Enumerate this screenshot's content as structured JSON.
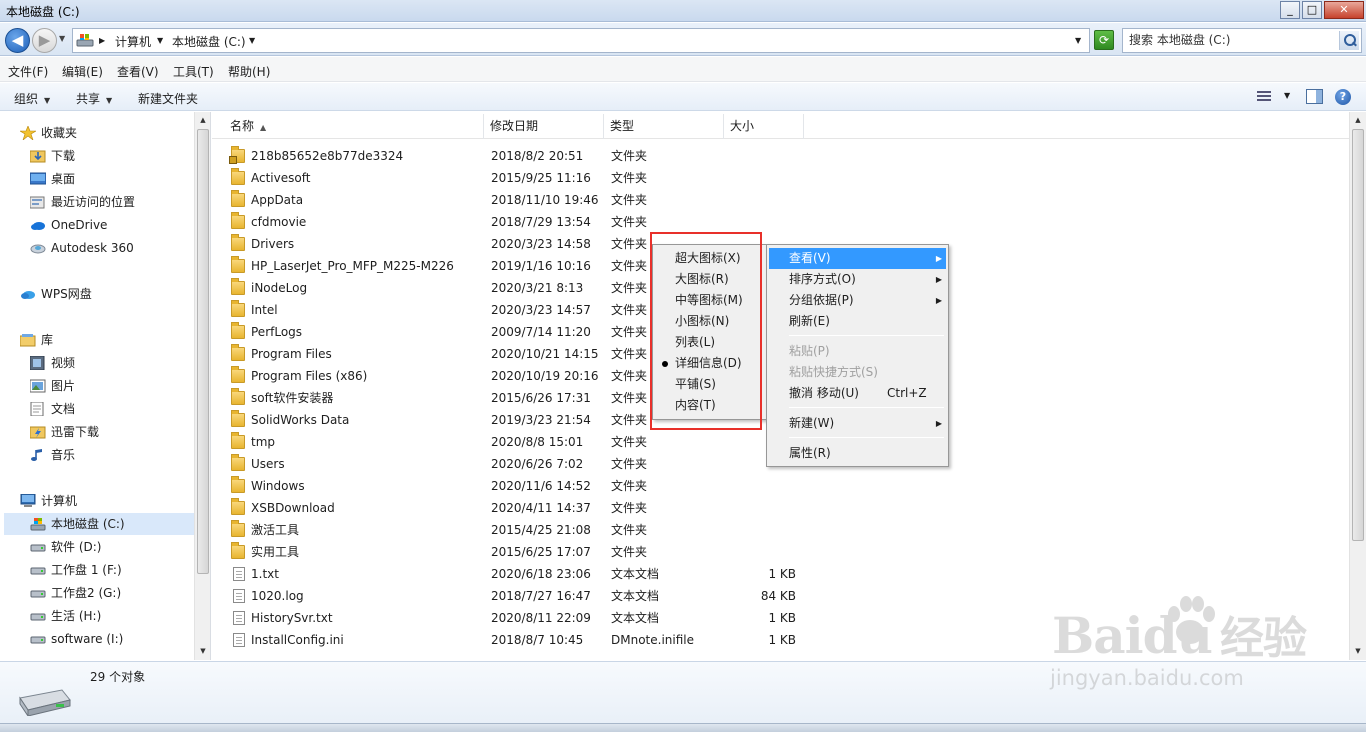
{
  "window": {
    "title": "本地磁盘 (C:)",
    "min": "_",
    "max": "□",
    "close": "✕"
  },
  "address": {
    "crumbs": [
      "计算机",
      "本地磁盘 (C:)"
    ]
  },
  "search": {
    "placeholder": "搜索 本地磁盘 (C:)"
  },
  "menubar": [
    "文件(F)",
    "编辑(E)",
    "查看(V)",
    "工具(T)",
    "帮助(H)"
  ],
  "commands": {
    "organize": "组织",
    "share": "共享",
    "new_folder": "新建文件夹"
  },
  "nav": {
    "favorites": "收藏夹",
    "favorite_items": [
      "下载",
      "桌面",
      "最近访问的位置"
    ],
    "onedrive": "OneDrive",
    "autodesk": "Autodesk 360",
    "wps": "WPS网盘",
    "libraries": "库",
    "library_items": [
      "视频",
      "图片",
      "文档",
      "迅雷下载",
      "音乐"
    ],
    "computer": "计算机",
    "drives": [
      "本地磁盘 (C:)",
      "软件 (D:)",
      "工作盘 1 (F:)",
      "工作盘2 (G:)",
      "生活 (H:)",
      "software (I:)"
    ]
  },
  "columns": {
    "name": "名称",
    "date": "修改日期",
    "type": "类型",
    "size": "大小"
  },
  "files": [
    {
      "name": "218b85652e8b77de3324",
      "date": "2018/8/2 20:51",
      "type": "文件夹",
      "size": "",
      "kind": "lock"
    },
    {
      "name": "Activesoft",
      "date": "2015/9/25 11:16",
      "type": "文件夹",
      "size": "",
      "kind": "folder"
    },
    {
      "name": "AppData",
      "date": "2018/11/10 19:46",
      "type": "文件夹",
      "size": "",
      "kind": "folder"
    },
    {
      "name": "cfdmovie",
      "date": "2018/7/29 13:54",
      "type": "文件夹",
      "size": "",
      "kind": "folder"
    },
    {
      "name": "Drivers",
      "date": "2020/3/23 14:58",
      "type": "文件夹",
      "size": "",
      "kind": "folder"
    },
    {
      "name": "HP_LaserJet_Pro_MFP_M225-M226",
      "date": "2019/1/16 10:16",
      "type": "文件夹",
      "size": "",
      "kind": "folder"
    },
    {
      "name": "iNodeLog",
      "date": "2020/3/21 8:13",
      "type": "文件夹",
      "size": "",
      "kind": "folder"
    },
    {
      "name": "Intel",
      "date": "2020/3/23 14:57",
      "type": "文件夹",
      "size": "",
      "kind": "folder"
    },
    {
      "name": "PerfLogs",
      "date": "2009/7/14 11:20",
      "type": "文件夹",
      "size": "",
      "kind": "folder"
    },
    {
      "name": "Program Files",
      "date": "2020/10/21 14:15",
      "type": "文件夹",
      "size": "",
      "kind": "folder"
    },
    {
      "name": "Program Files (x86)",
      "date": "2020/10/19 20:16",
      "type": "文件夹",
      "size": "",
      "kind": "folder"
    },
    {
      "name": "soft软件安装器",
      "date": "2015/6/26 17:31",
      "type": "文件夹",
      "size": "",
      "kind": "folder"
    },
    {
      "name": "SolidWorks Data",
      "date": "2019/3/23 21:54",
      "type": "文件夹",
      "size": "",
      "kind": "folder"
    },
    {
      "name": "tmp",
      "date": "2020/8/8 15:01",
      "type": "文件夹",
      "size": "",
      "kind": "folder"
    },
    {
      "name": "Users",
      "date": "2020/6/26 7:02",
      "type": "文件夹",
      "size": "",
      "kind": "folder"
    },
    {
      "name": "Windows",
      "date": "2020/11/6 14:52",
      "type": "文件夹",
      "size": "",
      "kind": "folder"
    },
    {
      "name": "XSBDownload",
      "date": "2020/4/11 14:37",
      "type": "文件夹",
      "size": "",
      "kind": "folder"
    },
    {
      "name": "激活工具",
      "date": "2015/4/25 21:08",
      "type": "文件夹",
      "size": "",
      "kind": "folder"
    },
    {
      "name": "实用工具",
      "date": "2015/6/25 17:07",
      "type": "文件夹",
      "size": "",
      "kind": "folder"
    },
    {
      "name": "1.txt",
      "date": "2020/6/18 23:06",
      "type": "文本文档",
      "size": "1 KB",
      "kind": "doc"
    },
    {
      "name": "1020.log",
      "date": "2018/7/27 16:47",
      "type": "文本文档",
      "size": "84 KB",
      "kind": "doc"
    },
    {
      "name": "HistorySvr.txt",
      "date": "2020/8/11 22:09",
      "type": "文本文档",
      "size": "1 KB",
      "kind": "doc"
    },
    {
      "name": "InstallConfig.ini",
      "date": "2018/8/7 10:45",
      "type": "DMnote.inifile",
      "size": "1 KB",
      "kind": "doc"
    }
  ],
  "status": {
    "count": "29 个对象"
  },
  "context_menu": {
    "view": "查看(V)",
    "sort": "排序方式(O)",
    "group": "分组依据(P)",
    "refresh": "刷新(E)",
    "paste": "粘贴(P)",
    "paste_shortcut": "粘贴快捷方式(S)",
    "undo": "撤消 移动(U)",
    "undo_accel": "Ctrl+Z",
    "new": "新建(W)",
    "properties": "属性(R)"
  },
  "view_submenu": {
    "items": [
      "超大图标(X)",
      "大图标(R)",
      "中等图标(M)",
      "小图标(N)",
      "列表(L)",
      "详细信息(D)",
      "平铺(S)",
      "内容(T)"
    ],
    "selected": "详细信息(D)"
  },
  "watermark": {
    "brand": "Baidu",
    "cn": "经验",
    "url": "jingyan.baidu.com"
  },
  "colors": {
    "highlight": "#3399ff",
    "annotation_box": "#e8302a",
    "selection": "#d9e8fa"
  }
}
